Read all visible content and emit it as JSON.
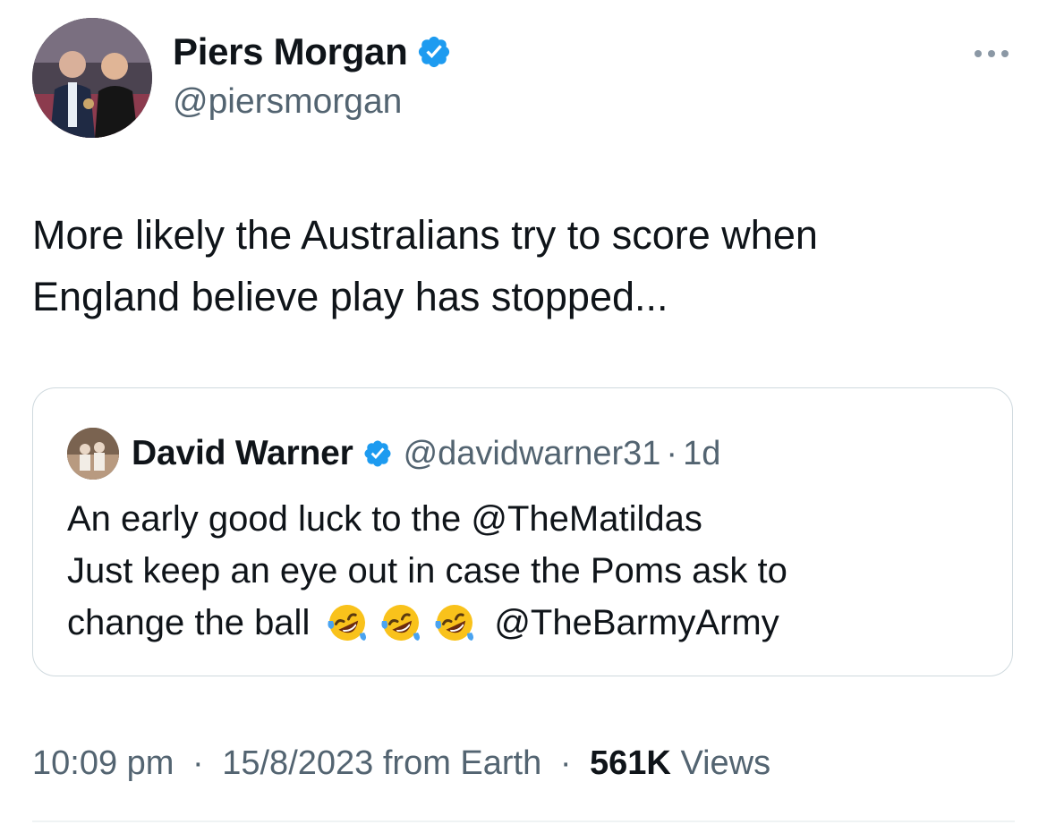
{
  "author": {
    "display_name": "Piers Morgan",
    "handle": "@piersmorgan",
    "verified_icon": "verified-badge-icon",
    "avatar_icon": "profile-photo"
  },
  "tweet": {
    "text_lines": [
      "More likely the Australians try to score when",
      "England believe play has stopped..."
    ]
  },
  "quote": {
    "display_name": "David Warner",
    "handle": "@davidwarner31",
    "separator": "·",
    "time": "1d",
    "text_lines": [
      "An early good luck to the @TheMatildas",
      "Just keep an eye out in case the Poms ask to",
      "change the ball"
    ],
    "emoji_name": "rolling-on-the-floor-laughing-emoji",
    "emoji_count": 3,
    "trailing_mention": "@TheBarmyArmy"
  },
  "meta": {
    "time": "10:09 pm",
    "date": "15/8/2023",
    "source": "from Earth",
    "separator": "·",
    "views_count": "561K",
    "views_label": "Views"
  },
  "colors": {
    "text": "#0f1419",
    "secondary": "#536471",
    "verified_blue": "#1d9bf0",
    "border": "#cfd9de"
  }
}
